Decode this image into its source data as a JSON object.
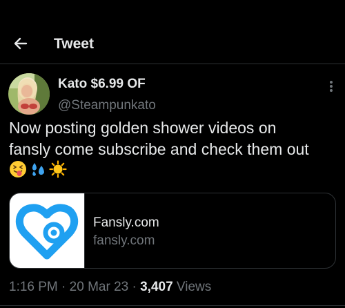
{
  "header": {
    "back_icon": "arrow-left-icon",
    "title": "Tweet"
  },
  "author": {
    "avatar_icon": "profile-photo",
    "display_name": "Kato $6.99 OF",
    "handle": "@Steampunkato"
  },
  "more_icon": "more-vertical-icon",
  "tweet": {
    "text_lines": [
      "Now posting golden shower videos on",
      "fansly come subscribe and check them out"
    ],
    "emojis": [
      "squinting-face-tongue-emoji",
      "sweat-droplets-emoji",
      "sun-emoji"
    ]
  },
  "link_card": {
    "logo_icon": "fansly-heart-logo",
    "title": "Fansly.com",
    "domain": "fansly.com"
  },
  "meta": {
    "time": "1:16 PM",
    "separator": " · ",
    "date": "20 Mar 23",
    "views_count": "3,407",
    "views_label": " Views"
  },
  "colors": {
    "background": "#000000",
    "text_primary": "#e7e9ea",
    "text_secondary": "#71767b",
    "border": "#2f3336",
    "fansly_blue": "#1fa0f1"
  }
}
